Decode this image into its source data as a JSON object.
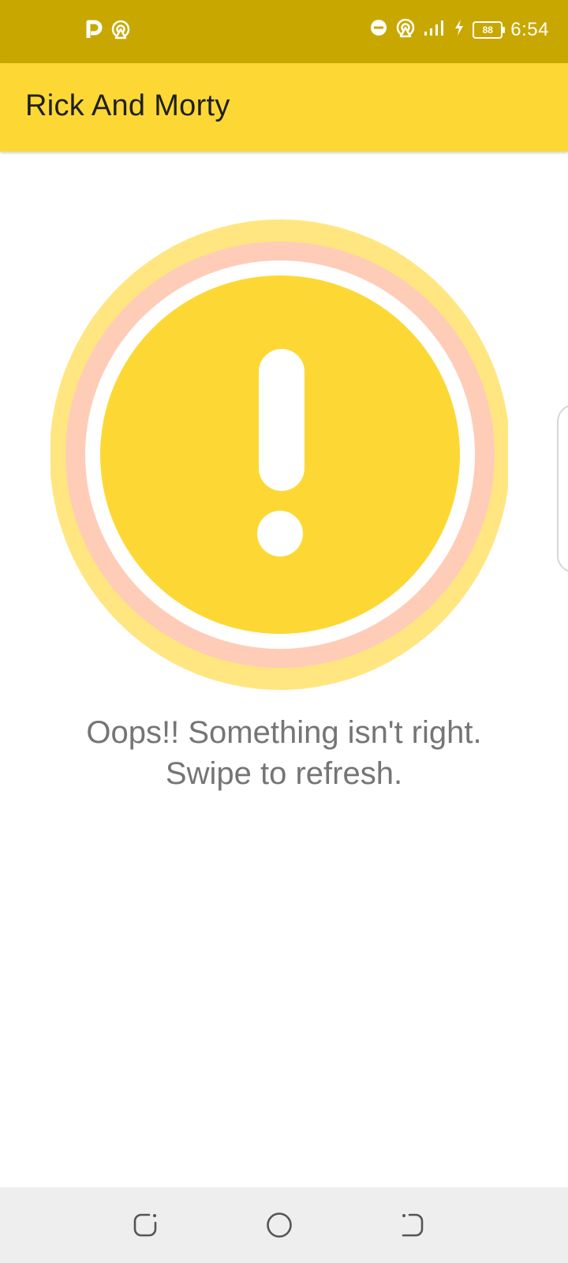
{
  "status_bar": {
    "time": "6:54",
    "battery_level": "88",
    "left_icons": [
      "parking-app-icon",
      "hotspot-icon"
    ],
    "right_icons": [
      "do-not-disturb-icon",
      "hotspot-icon",
      "signal-icon",
      "charging-icon",
      "battery-icon"
    ],
    "background_color": "#C8A800"
  },
  "app_bar": {
    "title": "Rick And Morty",
    "background_color": "#FDD835"
  },
  "error_state": {
    "icon": "exclamation-alert-icon",
    "message_line1": "Oops!! Something isn't right.",
    "message_line2": "Swipe to refresh.",
    "colors": {
      "outer_ring": "#FFE680",
      "middle_ring": "#FFCCB8",
      "inner_circle": "#FDD835",
      "text": "#757575"
    }
  },
  "nav_bar": {
    "buttons": [
      "recent-apps-icon",
      "home-icon",
      "back-icon"
    ],
    "background_color": "#EEEEEE"
  }
}
